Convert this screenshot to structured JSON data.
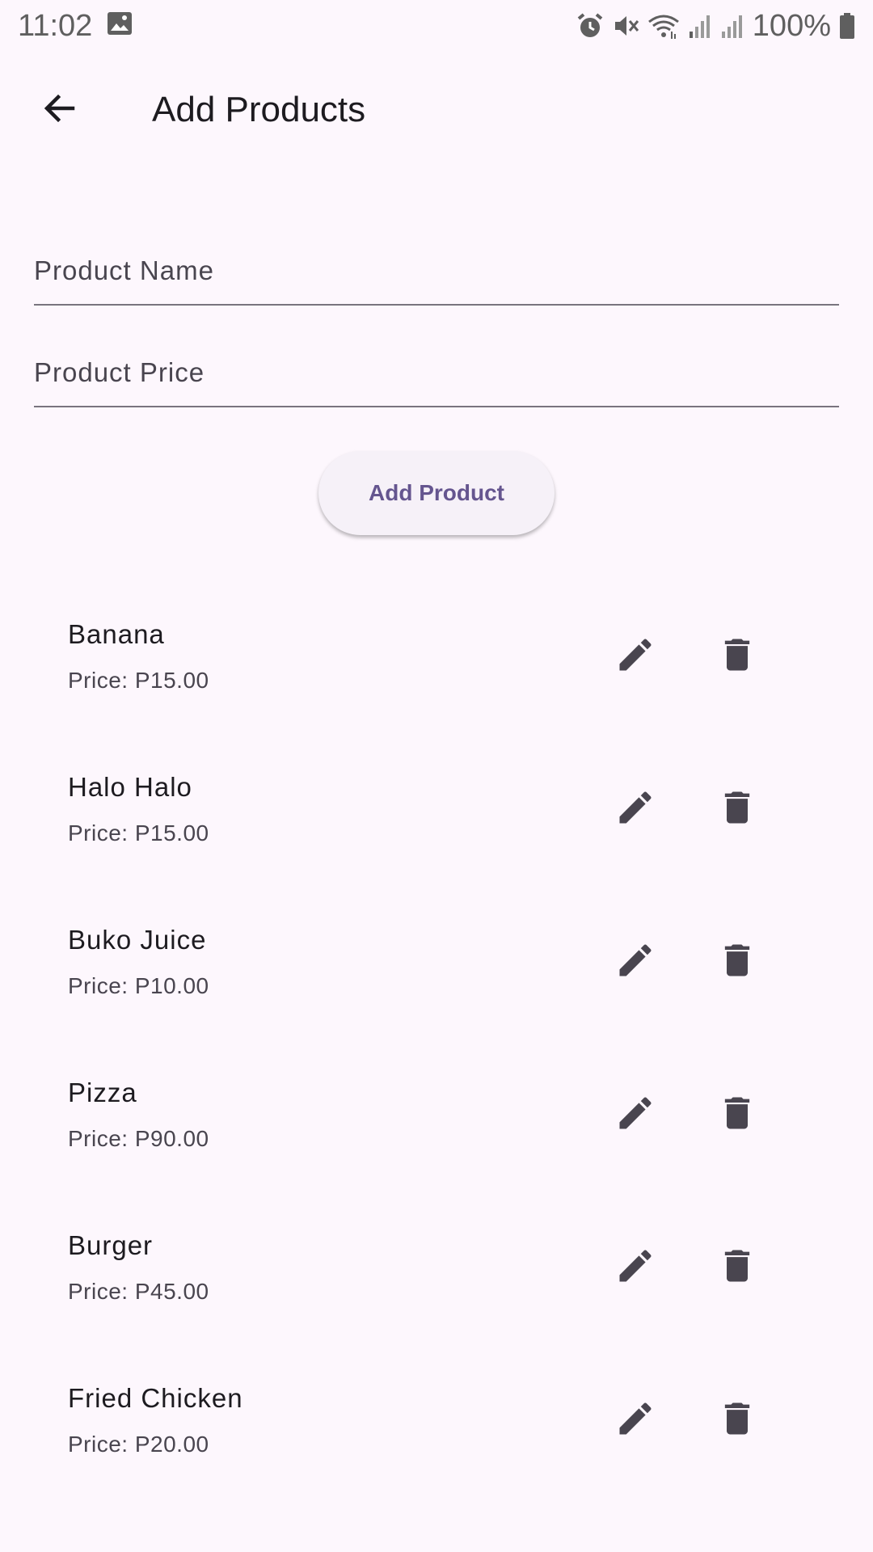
{
  "status_bar": {
    "time": "11:02",
    "battery": "100%",
    "icons": [
      "image-icon",
      "alarm-icon",
      "vibrate-off-icon",
      "wifi-icon",
      "signal-icon",
      "signal-icon",
      "battery-icon"
    ]
  },
  "app_bar": {
    "title": "Add Products",
    "back_icon": "arrow-back-icon"
  },
  "form": {
    "name_placeholder": "Product Name",
    "name_value": "",
    "price_placeholder": "Product Price",
    "price_value": "",
    "add_button_label": "Add Product"
  },
  "products": [
    {
      "name": "Banana",
      "price": "Price: P15.00"
    },
    {
      "name": "Halo Halo",
      "price": "Price: P15.00"
    },
    {
      "name": "Buko Juice",
      "price": "Price: P10.00"
    },
    {
      "name": "Pizza",
      "price": "Price: P90.00"
    },
    {
      "name": "Burger",
      "price": "Price: P45.00"
    },
    {
      "name": "Fried Chicken",
      "price": "Price: P20.00"
    }
  ],
  "colors": {
    "background": "#fdf7fd",
    "primary": "#65558f",
    "icon": "#49454f"
  },
  "row_icons": [
    "edit-icon",
    "delete-icon"
  ]
}
